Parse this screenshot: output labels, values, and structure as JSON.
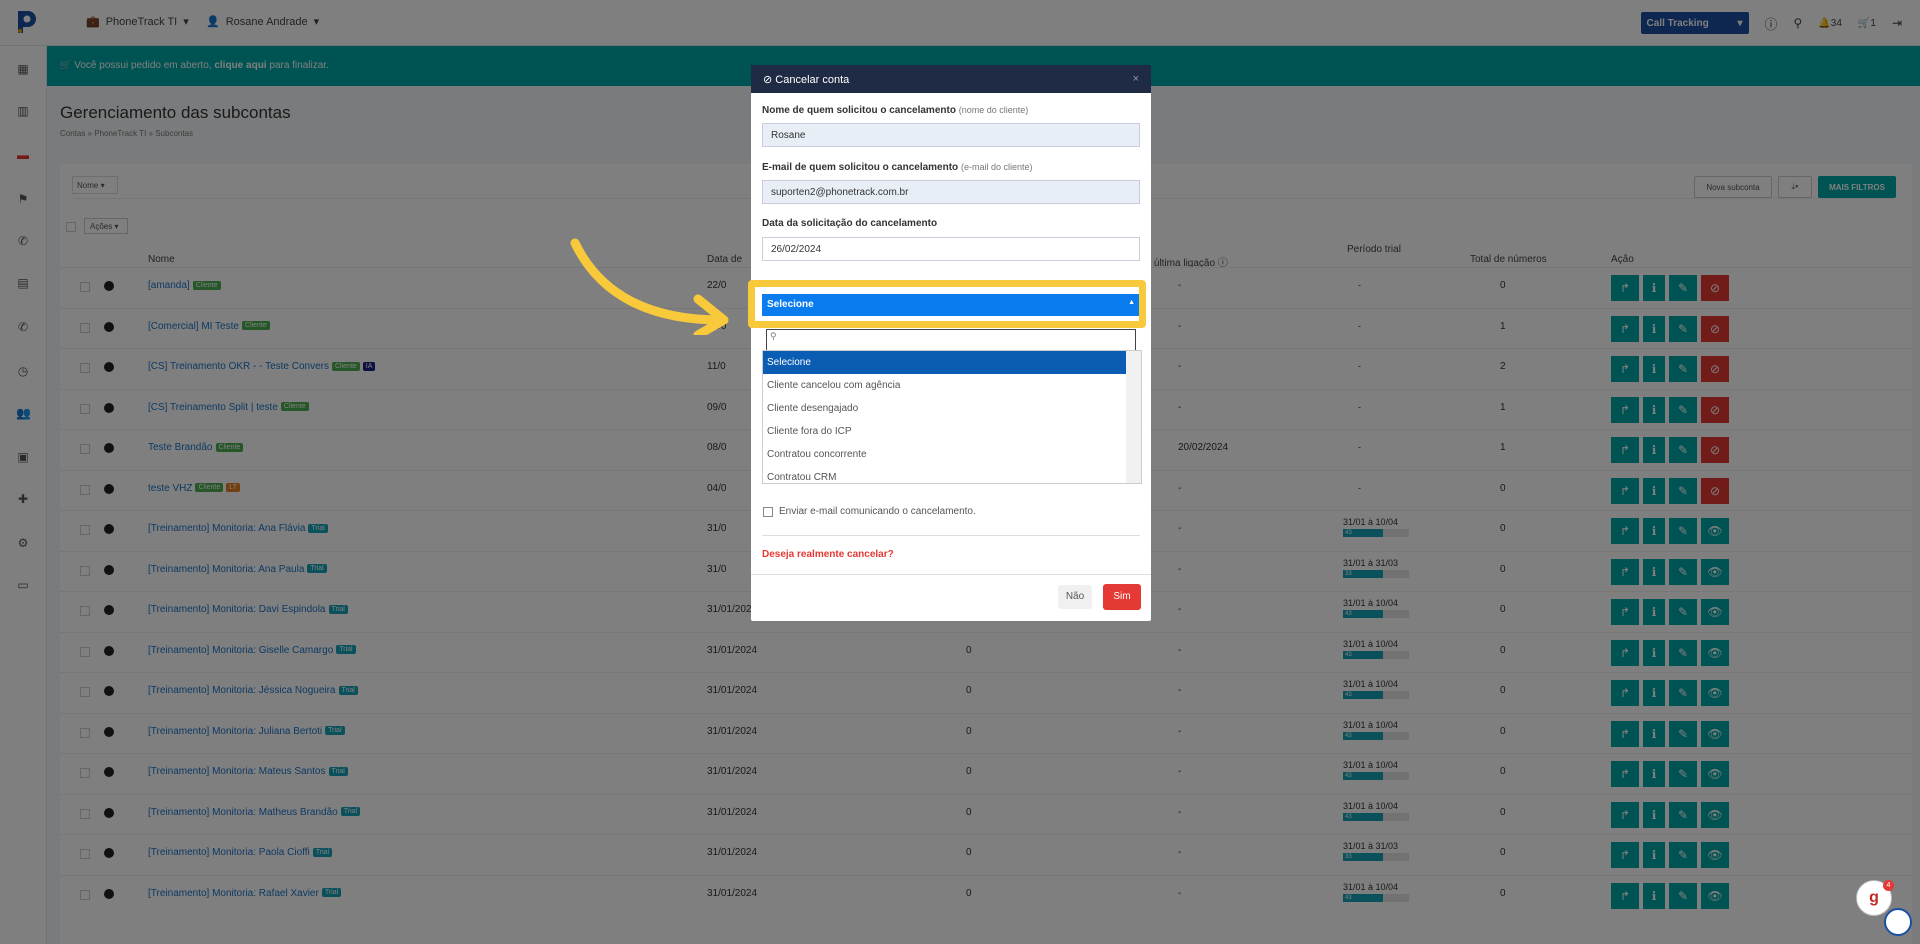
{
  "topbar": {
    "account": "PhoneTrack TI",
    "user": "Rosane Andrade",
    "product_select": "Call Tracking",
    "notifications_count": "34",
    "cart_count": "1"
  },
  "banner": {
    "text_before": "Você possui pedido em aberto,",
    "link": "clique aqui",
    "text_after": "para finalizar."
  },
  "page": {
    "title": "Gerenciamento das subcontas",
    "breadcrumb": [
      "Contas",
      "PhoneTrack TI",
      "Subcontas"
    ]
  },
  "toolbar": {
    "filter_label": "Nome",
    "new_button": "Nova subconta",
    "more_filters": "MAIS FILTROS",
    "actions_label": "Ações"
  },
  "table": {
    "headers": [
      "Nome",
      "Data de",
      "da última ligação",
      "Período trial",
      "Total de números",
      "Ação"
    ],
    "rows": [
      {
        "name": "[amanda]",
        "badge": "Cliente",
        "badge_type": "cliente",
        "date": "22/0",
        "c3": "",
        "last_call": "-",
        "trial": "-",
        "total": "0",
        "last_btn": "cancel"
      },
      {
        "name": "[Comercial] MI Teste",
        "badge": "Cliente",
        "badge_type": "cliente",
        "date": "20/0",
        "c3": "",
        "last_call": "-",
        "trial": "-",
        "total": "1",
        "last_btn": "cancel"
      },
      {
        "name": "[CS] Treinamento OKR - - Teste Convers",
        "badge": "Cliente",
        "badge_type": "cliente",
        "badge2": "IA",
        "date": "11/0",
        "c3": "",
        "last_call": "-",
        "trial": "-",
        "total": "2",
        "last_btn": "cancel"
      },
      {
        "name": "[CS] Treinamento Split | teste",
        "badge": "Cliente",
        "badge_type": "cliente",
        "date": "09/0",
        "c3": "",
        "last_call": "-",
        "trial": "-",
        "total": "1",
        "last_btn": "cancel"
      },
      {
        "name": "Teste Brandão",
        "badge": "Cliente",
        "badge_type": "cliente",
        "date": "08/0",
        "c3": "",
        "last_call": "20/02/2024",
        "trial": "-",
        "total": "1",
        "last_btn": "cancel"
      },
      {
        "name": "teste VHZ",
        "badge": "Cliente",
        "badge_type": "cliente",
        "badge2": "LT",
        "date": "04/0",
        "c3": "",
        "last_call": "-",
        "trial": "-",
        "total": "0",
        "last_btn": "cancel"
      },
      {
        "name": "[Treinamento] Monitoria: Ana Flávia",
        "badge": "Trial",
        "badge_type": "trial",
        "date": "31/0",
        "c3": "",
        "last_call": "-",
        "trial": "31/01 à 10/04",
        "trial_days": "43",
        "total": "0",
        "last_btn": "view"
      },
      {
        "name": "[Treinamento] Monitoria: Ana Paula",
        "badge": "Trial",
        "badge_type": "trial",
        "date": "31/0",
        "c3": "",
        "last_call": "-",
        "trial": "31/01 à 31/03",
        "trial_days": "33",
        "total": "0",
        "last_btn": "view"
      },
      {
        "name": "[Treinamento] Monitoria: Davi Espindola",
        "badge": "Trial",
        "badge_type": "trial",
        "date": "31/01/2024",
        "c3": "0",
        "last_call": "-",
        "trial": "31/01 à 10/04",
        "trial_days": "43",
        "total": "0",
        "last_btn": "view"
      },
      {
        "name": "[Treinamento] Monitoria: Giselle Camargo",
        "badge": "Trial",
        "badge_type": "trial",
        "date": "31/01/2024",
        "c3": "0",
        "last_call": "-",
        "trial": "31/01 à 10/04",
        "trial_days": "43",
        "total": "0",
        "last_btn": "view"
      },
      {
        "name": "[Treinamento] Monitoria: Jéssica Nogueira",
        "badge": "Trial",
        "badge_type": "trial",
        "date": "31/01/2024",
        "c3": "0",
        "last_call": "-",
        "trial": "31/01 à 10/04",
        "trial_days": "43",
        "total": "0",
        "last_btn": "view"
      },
      {
        "name": "[Treinamento] Monitoria: Juliana Bertoti",
        "badge": "Trial",
        "badge_type": "trial",
        "date": "31/01/2024",
        "c3": "0",
        "last_call": "-",
        "trial": "31/01 à 10/04",
        "trial_days": "43",
        "total": "0",
        "last_btn": "view"
      },
      {
        "name": "[Treinamento] Monitoria: Mateus Santos",
        "badge": "Trial",
        "badge_type": "trial",
        "date": "31/01/2024",
        "c3": "0",
        "last_call": "-",
        "trial": "31/01 à 10/04",
        "trial_days": "43",
        "total": "0",
        "last_btn": "view"
      },
      {
        "name": "[Treinamento] Monitoria: Matheus Brandão",
        "badge": "Trial",
        "badge_type": "trial",
        "date": "31/01/2024",
        "c3": "0",
        "last_call": "-",
        "trial": "31/01 à 10/04",
        "trial_days": "43",
        "total": "0",
        "last_btn": "view"
      },
      {
        "name": "[Treinamento] Monitoria: Paola Cioffi",
        "badge": "Trial",
        "badge_type": "trial",
        "date": "31/01/2024",
        "c3": "0",
        "last_call": "-",
        "trial": "31/01 à 31/03",
        "trial_days": "33",
        "total": "0",
        "last_btn": "view"
      },
      {
        "name": "[Treinamento] Monitoria: Rafael Xavier",
        "badge": "Trial",
        "badge_type": "trial",
        "date": "31/01/2024",
        "c3": "0",
        "last_call": "-",
        "trial": "31/01 à 10/04",
        "trial_days": "43",
        "total": "0",
        "last_btn": "view"
      }
    ]
  },
  "modal": {
    "title": "Cancelar conta",
    "requester_label": "Nome de quem solicitou o cancelamento",
    "requester_hint": "(nome do cliente)",
    "requester_value": "Rosane",
    "email_label": "E-mail de quem solicitou o cancelamento",
    "email_hint": "(e-mail do cliente)",
    "email_value": "suporten2@phonetrack.com.br",
    "date_label": "Data da solicitação do cancelamento",
    "date_value": "26/02/2024",
    "reason_selected": "Selecione",
    "options": [
      "Selecione",
      "Cliente cancelou com agência",
      "Cliente desengajado",
      "Cliente fora do ICP",
      "Contratou concorrente",
      "Contratou CRM"
    ],
    "send_email_label": "Enviar e-mail comunicando o cancelamento.",
    "confirm_question": "Deseja realmente cancelar?",
    "no_button": "Não",
    "yes_button": "Sim"
  },
  "colors": {
    "accent": "#00a6a6",
    "danger": "#e53935",
    "highlight": "#f8c93a",
    "select_blue": "#0a7cf0"
  }
}
